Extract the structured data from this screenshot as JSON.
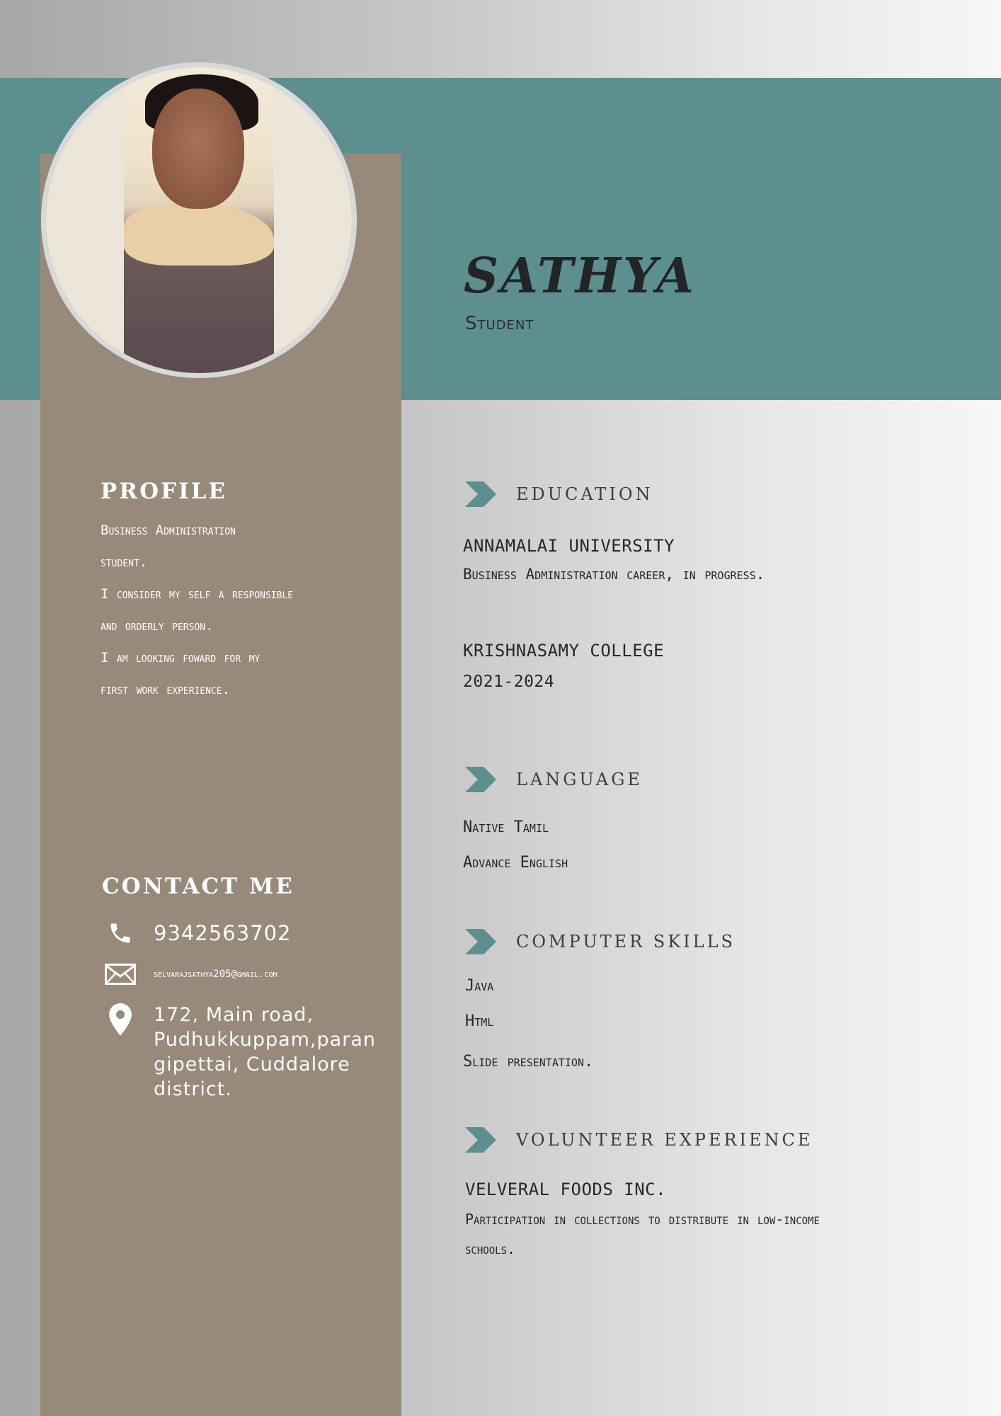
{
  "header": {
    "name": "SATHYA",
    "role": "Student"
  },
  "photo": {
    "alt": "profile-photo"
  },
  "profile": {
    "heading": "PROFILE",
    "lines": [
      "Business Administration",
      "student.",
      "I consider my self a responsible",
      "and orderly person.",
      "I am looking foward for my",
      "first work experience."
    ]
  },
  "contact": {
    "heading": "CONTACT ME",
    "phone": "9342563702",
    "email": "selvarajsathya205@gmail.com",
    "address_lines": [
      "172, Main road,",
      "Pudhukkuppam,paran",
      "gipettai, Cuddalore",
      "district."
    ]
  },
  "education": {
    "heading": "EDUCATION",
    "entries": [
      {
        "title": "ANNAMALAI UNIVERSITY",
        "detail": "Business Administration career, in progress."
      },
      {
        "title": "KRISHNASAMY COLLEGE",
        "detail": "2021-2024"
      }
    ]
  },
  "language": {
    "heading": "LANGUAGE",
    "items": [
      "Native Tamil",
      "Advance English"
    ]
  },
  "computer_skills": {
    "heading": "COMPUTER SKILLS",
    "items": [
      "Java",
      "Html",
      "Slide presentation."
    ]
  },
  "volunteer": {
    "heading": "VOLUNTEER EXPERIENCE",
    "title": "VELVERAL FOODS INC.",
    "detail_lines": [
      "Participation in collections to distribute in low-income",
      "schools."
    ]
  },
  "colors": {
    "teal_band": "#5d8f8f",
    "sidebar": "#978a7a",
    "chevron": "#5d8f8f",
    "text_dark": "#25272a",
    "text_light": "#ffffff"
  }
}
